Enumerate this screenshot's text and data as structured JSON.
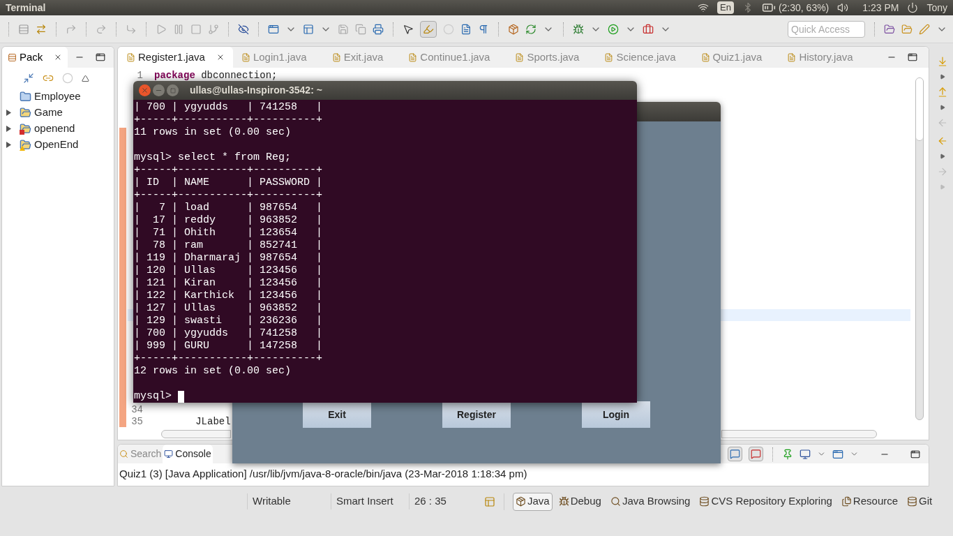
{
  "top_panel": {
    "app_title": "Terminal",
    "input_source": "En",
    "battery": "(2:30, 63%)",
    "clock": "1:23 PM",
    "user": "Tony"
  },
  "toolbar": {
    "quick_access": {
      "placeholder": "Quick Access"
    }
  },
  "package_explorer": {
    "tab": "Pack",
    "items": [
      {
        "label": "Employee",
        "kind": "folder",
        "expandable": false
      },
      {
        "label": "Game",
        "kind": "project",
        "expandable": true
      },
      {
        "label": "openend",
        "kind": "project-error",
        "expandable": true
      },
      {
        "label": "OpenEnd",
        "kind": "project-warning",
        "expandable": true
      }
    ]
  },
  "editor": {
    "tabs": [
      {
        "label": "Register1.java",
        "selected": true
      },
      {
        "label": "Login1.java",
        "selected": false
      },
      {
        "label": "Exit.java",
        "selected": false
      },
      {
        "label": "Continue1.java",
        "selected": false
      },
      {
        "label": "Sports.java",
        "selected": false
      },
      {
        "label": "Science.java",
        "selected": false
      },
      {
        "label": "Quiz1.java",
        "selected": false
      },
      {
        "label": "History.java",
        "selected": false
      }
    ],
    "first_line": {
      "number": "1",
      "keyword": "package",
      "text": " dbconnection;"
    },
    "last_lines": [
      {
        "number": "34"
      },
      {
        "number": "35",
        "text": "        JLabel"
      }
    ]
  },
  "console": {
    "tabs": [
      {
        "label": "Search",
        "selected": false
      },
      {
        "label": "Console",
        "selected": true
      }
    ],
    "output": "Quiz1 (3) [Java Application] /usr/lib/jvm/java-8-oracle/bin/java (23-Mar-2018 1:18:34 pm)"
  },
  "status_bar": {
    "fields": [
      "Writable",
      "Smart Insert",
      "26 : 35"
    ]
  },
  "perspectives": [
    {
      "label": "Java",
      "selected": true
    },
    {
      "label": "Debug",
      "selected": false
    },
    {
      "label": "Java Browsing",
      "selected": false
    },
    {
      "label": "CVS Repository Exploring",
      "selected": false
    },
    {
      "label": "Resource",
      "selected": false
    },
    {
      "label": "Git",
      "selected": false
    }
  ],
  "swing_window": {
    "buttons": [
      "Exit",
      "Register",
      "Login"
    ]
  },
  "terminal": {
    "title": "ullas@ullas-Inspiron-3542: ~",
    "blocks": [
      [
        "| 700 | ygyudds   | 741258   |",
        "+-----+-----------+----------+",
        "11 rows in set (0.00 sec)"
      ],
      [
        "mysql> select * from Reg;",
        "+-----+-----------+----------+",
        "| ID  | NAME      | PASSWORD |",
        "+-----+-----------+----------+",
        "|   7 | load      | 987654   |",
        "|  17 | reddy     | 963852   |",
        "|  71 | Ohith     | 123654   |",
        "|  78 | ram       | 852741   |",
        "| 119 | Dharmaraj | 987654   |",
        "| 120 | Ullas     | 123456   |",
        "| 121 | Kiran     | 123456   |",
        "| 122 | Karthick  | 123456   |",
        "| 127 | Ullas     | 963852   |",
        "| 129 | swasti    | 236236   |",
        "| 700 | ygyudds   | 741258   |",
        "| 999 | GURU      | 147258   |",
        "+-----+-----------+----------+",
        "12 rows in set (0.00 sec)"
      ]
    ],
    "prompt": "mysql>"
  }
}
